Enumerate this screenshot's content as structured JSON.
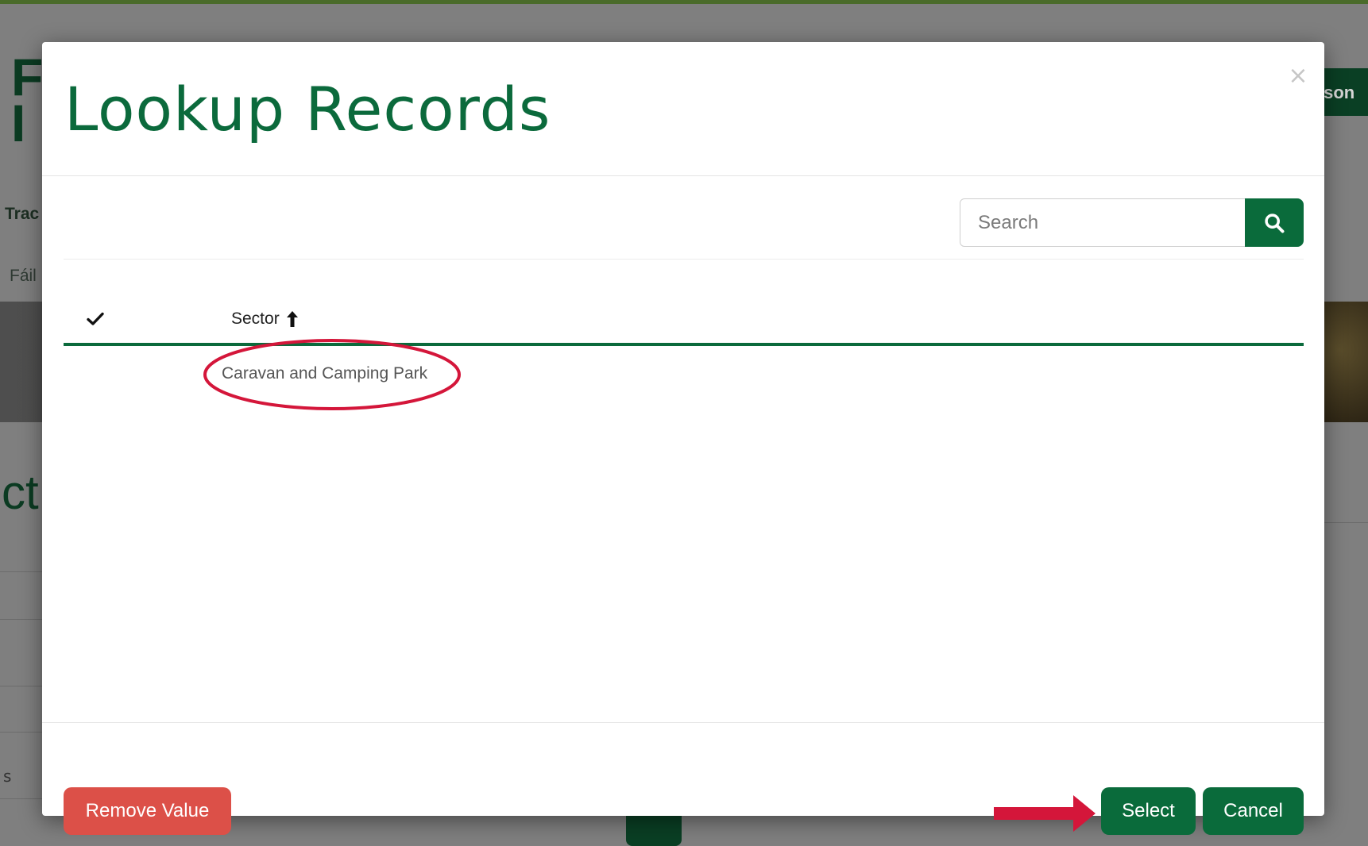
{
  "background": {
    "logo_line1": "F",
    "logo_line2": "I",
    "nav_fragment": "Trac",
    "lang_fragment": "Fáil",
    "heading_fragment": "ct",
    "right_button_fragment": "ison",
    "bottom_left_fragment": "s"
  },
  "modal": {
    "title": "Lookup Records",
    "close_symbol": "×",
    "search": {
      "placeholder": "Search",
      "value": ""
    },
    "grid": {
      "columns": [
        {
          "label": "Sector",
          "sort": "ascending"
        }
      ],
      "rows": [
        {
          "sector": "Caravan and Camping Park"
        }
      ]
    },
    "footer": {
      "remove_label": "Remove Value",
      "select_label": "Select",
      "cancel_label": "Cancel"
    }
  },
  "colors": {
    "brand_green": "#0a6b3b",
    "danger": "#dc5048",
    "annotation_red": "#d4163a"
  },
  "icons": {
    "search_button": "search-icon",
    "select_all": "check-icon",
    "sort": "arrow-up-icon",
    "close": "close-icon"
  }
}
